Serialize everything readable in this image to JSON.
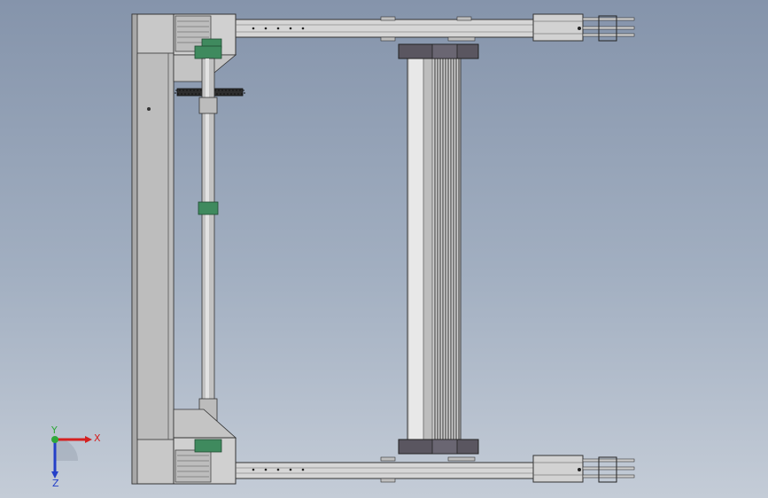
{
  "viewport": {
    "background_top": "#8594ab",
    "background_bottom": "#c4ccd7"
  },
  "colors": {
    "frame_fill": "#c9c9c9",
    "frame_dark": "#9a9a9a",
    "edge": "#3a3a3a",
    "rail_fill": "#d4d4d4",
    "roller_dark": "#4a4a4a",
    "cap_fill": "#5a5660",
    "bearing_green": "#3f8a5e",
    "sprocket": "#2e2e2e"
  },
  "triad": {
    "x_label": "X",
    "y_label": "Y",
    "z_label": "Z",
    "x_color": "#d42020",
    "y_color": "#2fa83a",
    "z_color": "#2440c8"
  }
}
